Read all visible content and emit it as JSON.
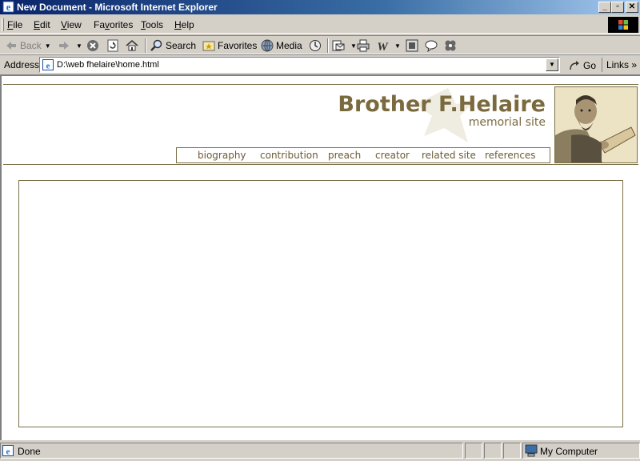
{
  "window": {
    "title": "New Document - Microsoft Internet Explorer"
  },
  "menu": [
    {
      "label": "File",
      "key": "F",
      "rest": "ile"
    },
    {
      "label": "Edit",
      "key": "E",
      "rest": "dit"
    },
    {
      "label": "View",
      "key": "V",
      "rest": "iew"
    },
    {
      "label": "Favorites",
      "key": "F",
      "rest": "avorites",
      "pre": ""
    },
    {
      "label": "Tools",
      "key": "T",
      "rest": "ools"
    },
    {
      "label": "Help",
      "key": "H",
      "rest": "elp"
    }
  ],
  "toolbar": {
    "back": "Back",
    "search": "Search",
    "favorites": "Favorites",
    "media": "Media"
  },
  "address": {
    "label": "Address",
    "url": "D:\\web fhelaire\\home.html",
    "go": "Go",
    "links": "Links"
  },
  "site": {
    "title": "Brother F.Helaire",
    "subtitle": "memorial site",
    "nav": [
      "biography",
      "contribution",
      "preach",
      "creator",
      "related site",
      "references"
    ]
  },
  "status": {
    "text": "Done",
    "zone": "My Computer"
  },
  "colors": {
    "accent": "#7a6a3e",
    "titlebar": "#0a246a",
    "chrome": "#d4d0c8"
  }
}
